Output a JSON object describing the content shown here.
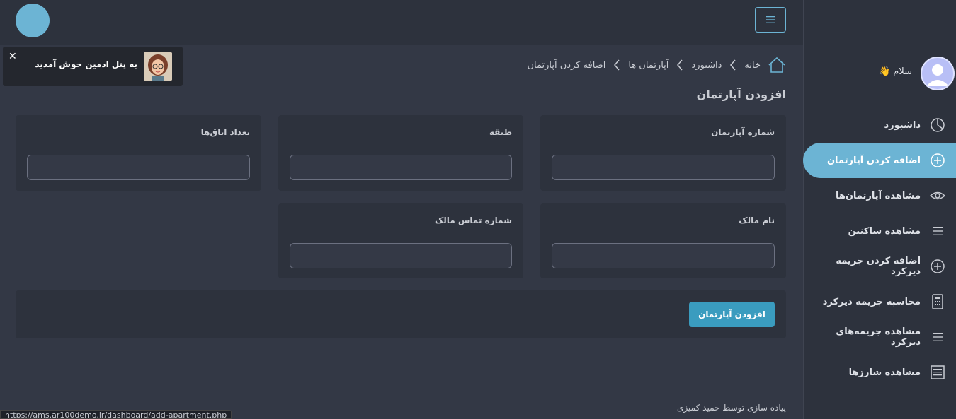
{
  "header": {
    "menu_icon": "hamburger-icon"
  },
  "sidebar": {
    "greeting": "سلام 👋",
    "items": [
      {
        "label": "داشبورد",
        "icon": "pie-chart-icon"
      },
      {
        "label": "اضافه کردن آپارتمان",
        "icon": "plus-circle-icon",
        "active": true
      },
      {
        "label": "مشاهده آپارتمان‌ها",
        "icon": "eye-icon"
      },
      {
        "label": "مشاهده ساکنین",
        "icon": "list-icon"
      },
      {
        "label": "اضافه کردن جریمه دیرکرد",
        "icon": "plus-circle-icon"
      },
      {
        "label": "محاسبه جریمه دیرکرد",
        "icon": "calculator-icon"
      },
      {
        "label": "مشاهده جریمه‌های دیرکرد",
        "icon": "list-icon"
      },
      {
        "label": "مشاهده شارژها",
        "icon": "receipt-icon"
      }
    ]
  },
  "toast": {
    "message": "به پنل ادمین خوش آمدید",
    "close": "✕"
  },
  "breadcrumb": {
    "items": [
      "خانه",
      "داشبورد",
      "آپارتمان ها",
      "اضافه کردن آپارتمان"
    ]
  },
  "page": {
    "title": "افزودن آپارتمان"
  },
  "form": {
    "apartment_number": {
      "label": "شماره آپارتمان",
      "value": ""
    },
    "floor": {
      "label": "طبقه",
      "value": ""
    },
    "room_count": {
      "label": "تعداد اتاق‌ها",
      "value": ""
    },
    "owner_name": {
      "label": "نام مالک",
      "value": ""
    },
    "owner_phone": {
      "label": "شماره تماس مالک",
      "value": ""
    },
    "submit_label": "افزودن آپارتمان"
  },
  "footer": {
    "credit": "پیاده سازی توسط حمید کمیزی"
  },
  "statusbar": {
    "url": "https://ams.ar100demo.ir/dashboard/add-apartment.php"
  },
  "colors": {
    "accent": "#6cb4d4",
    "button": "#3a9cbf",
    "background": "#333845",
    "panel": "#2d323d"
  }
}
